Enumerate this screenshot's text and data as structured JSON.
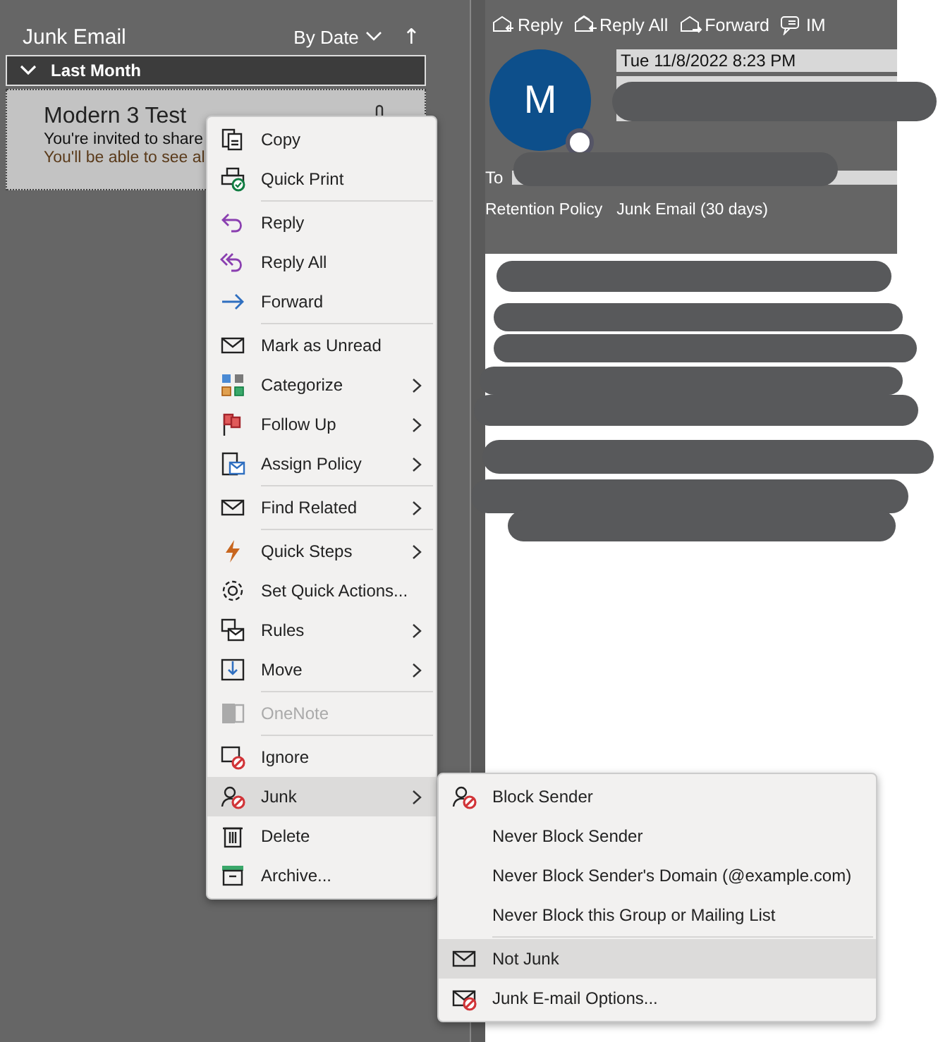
{
  "folder": {
    "title": "Junk Email",
    "sort": "By Date",
    "sort_direction": "↑"
  },
  "group": {
    "label": "Last Month",
    "expanded": true
  },
  "message": {
    "sender": "Modern 3 Test",
    "subject": "You're invited to share",
    "preview": "You'll be able to see al",
    "attachment": true,
    "selected": true
  },
  "reading_pane": {
    "actions": [
      "Reply",
      "Reply All",
      "Forward",
      "IM"
    ],
    "avatar": "M",
    "date": "Tue 11/8/2022 8:23 PM",
    "to_label": "To",
    "policy_label": "Retention Policy",
    "policy": "Junk Email (30 days)"
  },
  "context_menu": [
    {
      "label": "Copy",
      "submenu": false,
      "disabled": false,
      "selected": false,
      "separator_before": false
    },
    {
      "label": "Quick Print",
      "submenu": false,
      "disabled": false,
      "selected": false,
      "separator_before": false
    },
    {
      "label": "Reply",
      "submenu": false,
      "disabled": false,
      "selected": false,
      "separator_before": true
    },
    {
      "label": "Reply All",
      "submenu": false,
      "disabled": false,
      "selected": false,
      "separator_before": false
    },
    {
      "label": "Forward",
      "submenu": false,
      "disabled": false,
      "selected": false,
      "separator_before": false
    },
    {
      "label": "Mark as Unread",
      "submenu": false,
      "disabled": false,
      "selected": false,
      "separator_before": true
    },
    {
      "label": "Categorize",
      "submenu": true,
      "disabled": false,
      "selected": false,
      "separator_before": false
    },
    {
      "label": "Follow Up",
      "submenu": true,
      "disabled": false,
      "selected": false,
      "separator_before": false
    },
    {
      "label": "Assign Policy",
      "submenu": true,
      "disabled": false,
      "selected": false,
      "separator_before": false
    },
    {
      "label": "Find Related",
      "submenu": true,
      "disabled": false,
      "selected": false,
      "separator_before": true
    },
    {
      "label": "Quick Steps",
      "submenu": true,
      "disabled": false,
      "selected": false,
      "separator_before": true
    },
    {
      "label": "Set Quick Actions...",
      "submenu": false,
      "disabled": false,
      "selected": false,
      "separator_before": false
    },
    {
      "label": "Rules",
      "submenu": true,
      "disabled": false,
      "selected": false,
      "separator_before": false
    },
    {
      "label": "Move",
      "submenu": true,
      "disabled": false,
      "selected": false,
      "separator_before": false
    },
    {
      "label": "OneNote",
      "submenu": false,
      "disabled": true,
      "selected": false,
      "separator_before": true
    },
    {
      "label": "Ignore",
      "submenu": false,
      "disabled": false,
      "selected": false,
      "separator_before": true
    },
    {
      "label": "Junk",
      "submenu": true,
      "disabled": false,
      "selected": true,
      "separator_before": false
    },
    {
      "label": "Delete",
      "submenu": false,
      "disabled": false,
      "selected": false,
      "separator_before": false
    },
    {
      "label": "Archive...",
      "submenu": false,
      "disabled": false,
      "selected": false,
      "separator_before": false
    }
  ],
  "junk_submenu": [
    {
      "label": "Block Sender",
      "selected": false,
      "separator_before": false
    },
    {
      "label": "Never Block Sender",
      "selected": false,
      "separator_before": false
    },
    {
      "label": "Never Block Sender's Domain (@example.com)",
      "selected": false,
      "separator_before": false
    },
    {
      "label": "Never Block this Group or Mailing List",
      "selected": false,
      "separator_before": false
    },
    {
      "label": "Not Junk",
      "selected": true,
      "separator_before": true
    },
    {
      "label": "Junk E-mail Options...",
      "selected": false,
      "separator_before": false
    }
  ]
}
